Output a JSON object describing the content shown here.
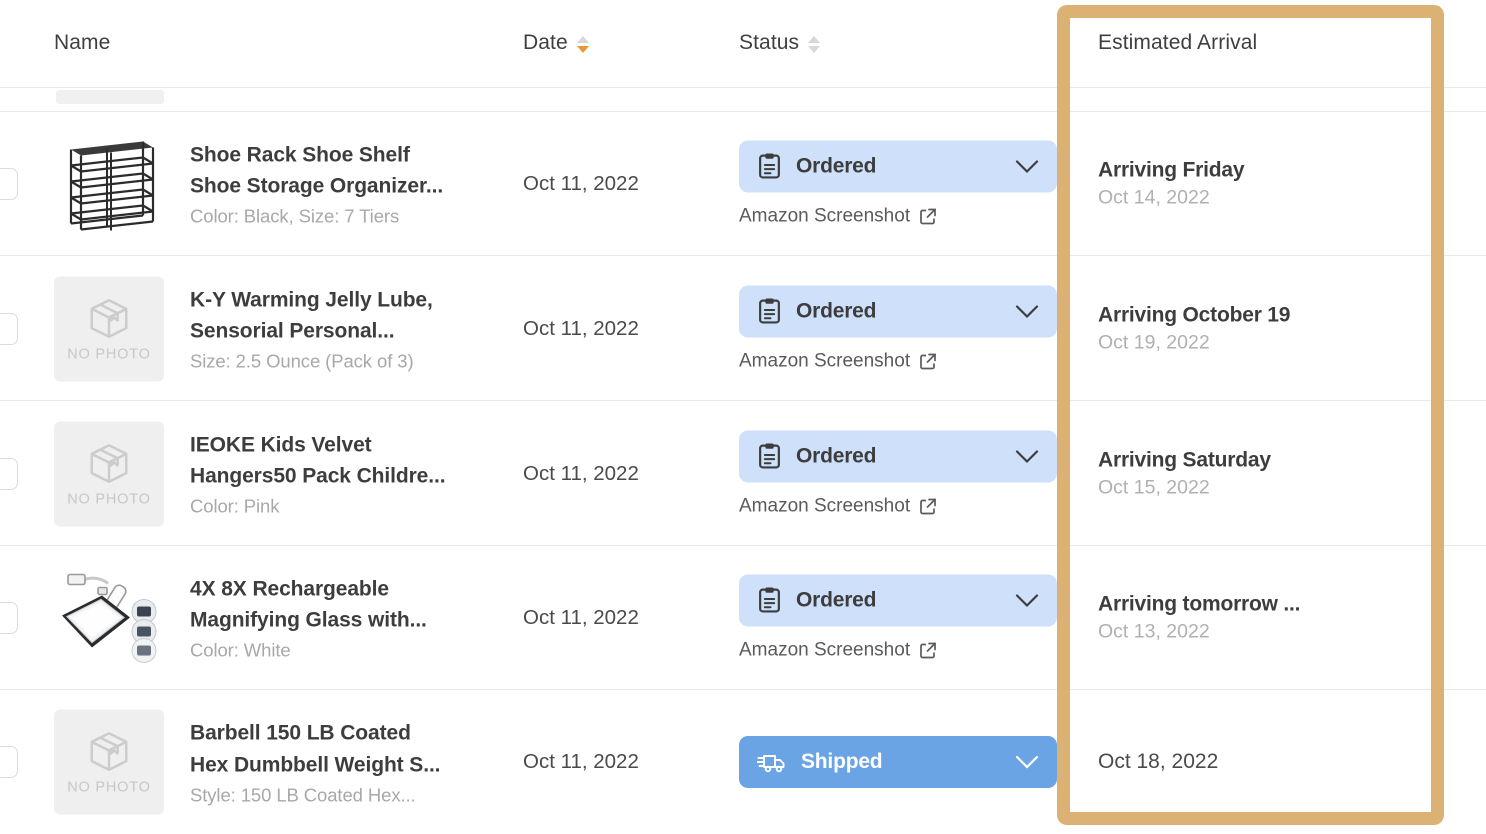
{
  "header": {
    "columns": [
      {
        "label": "Name",
        "sortable": false,
        "sort": "none"
      },
      {
        "label": "Date",
        "sortable": true,
        "sort": "desc"
      },
      {
        "label": "Status",
        "sortable": true,
        "sort": "none"
      },
      {
        "label": "Estimated Arrival",
        "sortable": false,
        "sort": "none"
      }
    ]
  },
  "colors": {
    "highlight_border": "#dcb274",
    "ordered_badge_bg": "#cfe0fb",
    "shipped_badge_bg": "#6ba4e4",
    "active_sort_arrow": "#e8982f",
    "row_divider": "#e9e9e9"
  },
  "placeholder": {
    "no_photo_label": "NO PHOTO"
  },
  "link_label": "Amazon Screenshot",
  "rows": [
    {
      "name": "Shoe Rack Shoe Shelf Shoe Storage Organizer...",
      "name_line1": "Shoe Rack Shoe Shelf",
      "name_line2": "Shoe Storage Organizer...",
      "variant": "Color: Black, Size: 7 Tiers",
      "date": "Oct 11, 2022",
      "status": "Ordered",
      "status_icon": "clipboard-icon",
      "screenshot_label": "Amazon Screenshot",
      "eta_title": "Arriving Friday",
      "eta_date": "Oct 14, 2022",
      "has_photo": true,
      "photo": "shoe-rack"
    },
    {
      "name": "K-Y Warming Jelly Lube, Sensorial Personal...",
      "name_line1": "K-Y Warming Jelly Lube,",
      "name_line2": "Sensorial Personal...",
      "variant": "Size: 2.5 Ounce (Pack of 3)",
      "date": "Oct 11, 2022",
      "status": "Ordered",
      "status_icon": "clipboard-icon",
      "screenshot_label": "Amazon Screenshot",
      "eta_title": "Arriving October 19",
      "eta_date": "Oct 19, 2022",
      "has_photo": false,
      "photo": "no-photo"
    },
    {
      "name": "IEOKE Kids Velvet Hangers50 Pack Childre...",
      "name_line1": "IEOKE Kids Velvet",
      "name_line2": "Hangers50 Pack Childre...",
      "variant": "Color: Pink",
      "date": "Oct 11, 2022",
      "status": "Ordered",
      "status_icon": "clipboard-icon",
      "screenshot_label": "Amazon Screenshot",
      "eta_title": "Arriving Saturday",
      "eta_date": "Oct 15, 2022",
      "has_photo": false,
      "photo": "no-photo"
    },
    {
      "name": "4X 8X Rechargeable Magnifying Glass with...",
      "name_line1": "4X 8X Rechargeable",
      "name_line2": "Magnifying Glass with...",
      "variant": "Color: White",
      "date": "Oct 11, 2022",
      "status": "Ordered",
      "status_icon": "clipboard-icon",
      "screenshot_label": "Amazon Screenshot",
      "eta_title": "Arriving tomorrow ...",
      "eta_date": "Oct 13, 2022",
      "has_photo": true,
      "photo": "magnifier"
    },
    {
      "name": "Barbell 150 LB Coated Hex Dumbbell Weight S...",
      "name_line1": "Barbell 150 LB Coated",
      "name_line2": "Hex Dumbbell Weight S...",
      "variant": "Style: 150 LB Coated Hex...",
      "date": "Oct 11, 2022",
      "status": "Shipped",
      "status_icon": "truck-icon",
      "screenshot_label": "",
      "eta_title": "",
      "eta_date": "Oct 18, 2022",
      "has_photo": false,
      "photo": "no-photo"
    }
  ]
}
